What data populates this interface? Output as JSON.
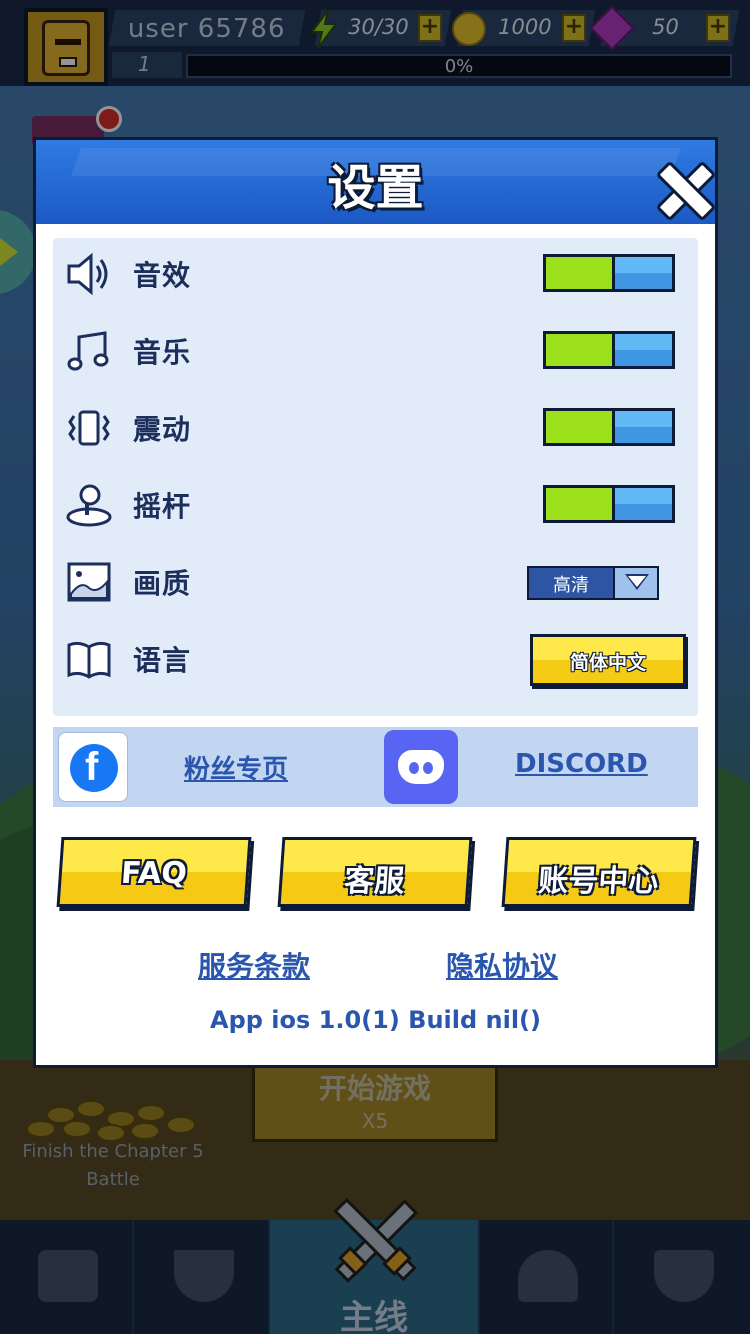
{
  "hud": {
    "username": "user 65786",
    "level": "1",
    "xp_progress": "0%",
    "energy": "30/30",
    "coins": "1000",
    "gems": "50"
  },
  "background": {
    "start_button_label": "开始游戏",
    "start_button_cost": "X5",
    "chapter_task": "Finish the Chapter 5 Battle"
  },
  "bottom_nav": {
    "active_label": "主线"
  },
  "settings": {
    "title": "设置",
    "rows": [
      {
        "label": "音效",
        "icon": "speaker-icon",
        "control": "toggle",
        "on": true
      },
      {
        "label": "音乐",
        "icon": "music-note-icon",
        "control": "toggle",
        "on": true
      },
      {
        "label": "震动",
        "icon": "vibration-icon",
        "control": "toggle",
        "on": true
      },
      {
        "label": "摇杆",
        "icon": "joystick-icon",
        "control": "toggle",
        "on": true
      },
      {
        "label": "画质",
        "icon": "image-icon",
        "control": "select",
        "value": "高清"
      },
      {
        "label": "语言",
        "icon": "book-icon",
        "control": "button",
        "value": "简体中文"
      }
    ],
    "social": {
      "facebook_label": "粉丝专页",
      "discord_label": "DISCORD"
    },
    "buttons": {
      "faq": "FAQ",
      "support": "客服",
      "account": "账号中心"
    },
    "links": {
      "terms": "服务条款",
      "privacy": "隐私协议"
    },
    "version": "App ios 1.0(1) Build nil()"
  },
  "colors": {
    "header_blue": "#1c59c4",
    "toggle_on": "#9be01a",
    "toggle_knob": "#3f97e3",
    "button_yellow": "#f5c914",
    "link_blue": "#2a56ad"
  }
}
